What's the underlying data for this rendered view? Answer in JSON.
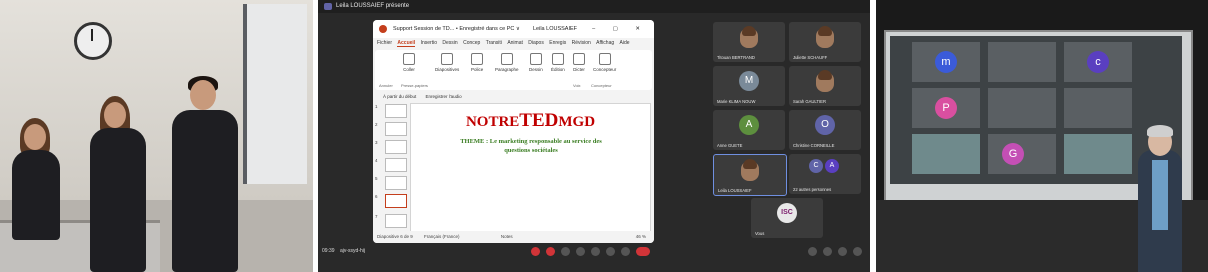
{
  "teams": {
    "presenter_banner": "Leila LOUSSAIEF présente",
    "time": "09:39",
    "meeting_code": "ajv-ssyd-hij"
  },
  "powerpoint": {
    "title": "Support Session de TD...",
    "save_state": "• Enregistré dans ce PC ∨",
    "user": "Leila LOUSSAIEF",
    "window_controls": "–  ▢  ✕",
    "menu": [
      "Fichier",
      "Accueil",
      "Insertio",
      "Dessin",
      "Concep",
      "Transiti",
      "Animat",
      "Diapos",
      "Enregis",
      "Révision",
      "Affichag",
      "Aide"
    ],
    "ribbon": {
      "buttons": [
        "Coller",
        "Diapositives",
        "Police",
        "Paragraphe",
        "Dessin",
        "Édition",
        "Dicter",
        "Concepteur"
      ],
      "groups": [
        "Annuler",
        "Presse-papiers",
        "Voix",
        "Concepteur"
      ]
    },
    "quick_bar": {
      "from_start": "À partir du début",
      "record_audio": "Enregistrer l'audio"
    },
    "thumb_numbers": [
      "1",
      "2",
      "3",
      "4",
      "5",
      "6",
      "7"
    ],
    "slide": {
      "brand_pre": "NOTRE",
      "brand_mid": "TED",
      "brand_post": "MGD",
      "theme_line1": "THEME : Le marketing responsable au service des",
      "theme_line2": "questions sociétales"
    },
    "status": {
      "slide_info": "Diapositive 6 de 9",
      "language": "Français (France)",
      "notes": "Notes",
      "zoom": "46 %"
    }
  },
  "participants": [
    {
      "name": "Titouan BERTRAND",
      "type": "photo"
    },
    {
      "name": "Juliette SCHAUFF",
      "type": "photo"
    },
    {
      "name": "Marie KLIMA NOUW",
      "type": "initial",
      "initial": "M",
      "color": "#7a8a99"
    },
    {
      "name": "Sarah GAULTIER",
      "type": "photo"
    },
    {
      "name": "Anne GUETE",
      "type": "initial",
      "initial": "A",
      "color": "#5d8f3e"
    },
    {
      "name": "Christine CORNEILLE",
      "type": "initial",
      "initial": "O",
      "color": "#6064a8"
    },
    {
      "name": "Leila LOUSSAIEF",
      "type": "photo"
    },
    {
      "name": "22 autres personnes",
      "type": "more",
      "initials": [
        "C",
        "A"
      ]
    },
    {
      "name": "Vous",
      "type": "logo",
      "logo_text": "ISC"
    }
  ],
  "projection": {
    "tiles": [
      {
        "initial": "m",
        "color": "#3b5bd9"
      },
      {
        "initial": "",
        "color": ""
      },
      {
        "initial": "c",
        "color": "#5a3fc0"
      },
      {
        "initial": "P",
        "color": "#d94fa0"
      },
      {
        "initial": "",
        "color": ""
      },
      {
        "initial": "",
        "color": ""
      },
      {
        "initial": "",
        "color": ""
      },
      {
        "initial": "G",
        "color": "#c44fb5"
      },
      {
        "initial": "",
        "color": ""
      }
    ]
  }
}
